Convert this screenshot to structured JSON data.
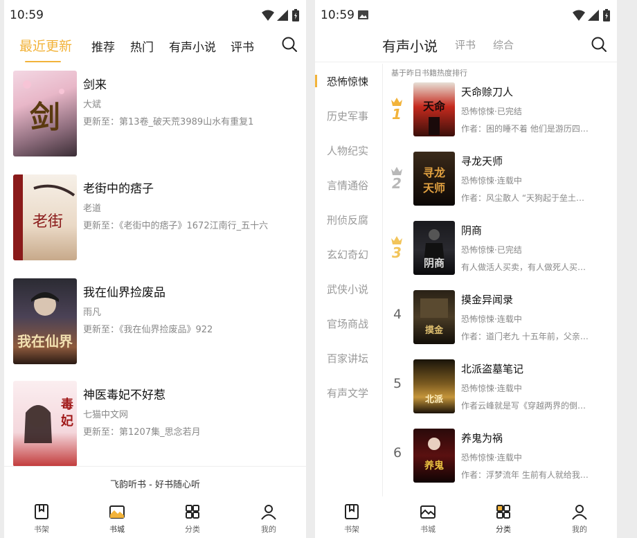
{
  "left": {
    "status_time": "10:59",
    "tabs": [
      "最近更新",
      "推荐",
      "热门",
      "有声小说",
      "评书"
    ],
    "books": [
      {
        "title": "剑来",
        "author": "大斌",
        "update": "更新至：第13卷_破天荒3989山水有重复1",
        "cover_text": "剑来"
      },
      {
        "title": "老街中的痞子",
        "author": "老道",
        "update": "更新至：《老街中的痞子》1672江南行_五十六",
        "cover_text": "老街中的痞"
      },
      {
        "title": "我在仙界捡废品",
        "author": "雨凡",
        "update": "更新至：《我在仙界捡废品》922",
        "cover_text": "我在仙界"
      },
      {
        "title": "神医毒妃不好惹",
        "author": "七猫中文网",
        "update": "更新至：第1207集_思念若月",
        "cover_text": "毒妃不好惹"
      }
    ],
    "footer": "飞韵听书 - 好书随心听",
    "nav": [
      "书架",
      "书城",
      "分类",
      "我的"
    ]
  },
  "right": {
    "status_time": "10:59",
    "tabs": [
      "有声小说",
      "评书",
      "综合"
    ],
    "categories": [
      "恐怖惊悚",
      "历史军事",
      "人物纪实",
      "言情通俗",
      "刑侦反腐",
      "玄幻奇幻",
      "武侠小说",
      "官场商战",
      "百家讲坛",
      "有声文学"
    ],
    "caption": "基于昨日书籍热度排行",
    "rankings": [
      {
        "rank": "1",
        "title": "天命赊刀人",
        "meta": "恐怖惊悚·已完结",
        "desc": "作者：困的睡不着 他们是游历四…",
        "cover_text": "天命赊刀人"
      },
      {
        "rank": "2",
        "title": "寻龙天师",
        "meta": "恐怖惊悚·连载中",
        "desc": "作者：风尘散人 “天狗起于垒土…",
        "cover_text": "寻龙天师"
      },
      {
        "rank": "3",
        "title": "阴商",
        "meta": "恐怖惊悚·已完结",
        "desc": "有人做活人买卖，有人做死人买…",
        "cover_text": "阴商"
      },
      {
        "rank": "4",
        "title": "摸金异闻录",
        "meta": "恐怖惊悚·连载中",
        "desc": "作者：道门老九 十五年前，父亲…",
        "cover_text": "摸金异闻录"
      },
      {
        "rank": "5",
        "title": "北派盗墓笔记",
        "meta": "恐怖惊悚·连载中",
        "desc": "作者云峰就是写《穿越两界的倒…",
        "cover_text": "北派盗墓"
      },
      {
        "rank": "6",
        "title": "养鬼为祸",
        "meta": "恐怖惊悚·连载中",
        "desc": "作者：浮梦流年 生前有人就给我…",
        "cover_text": "养鬼为祸"
      }
    ],
    "nav": [
      "书架",
      "书城",
      "分类",
      "我的"
    ]
  },
  "colors": {
    "accent": "#f2b33a",
    "silver": "#b8b8b8",
    "text": "#222222",
    "muted": "#888888"
  }
}
